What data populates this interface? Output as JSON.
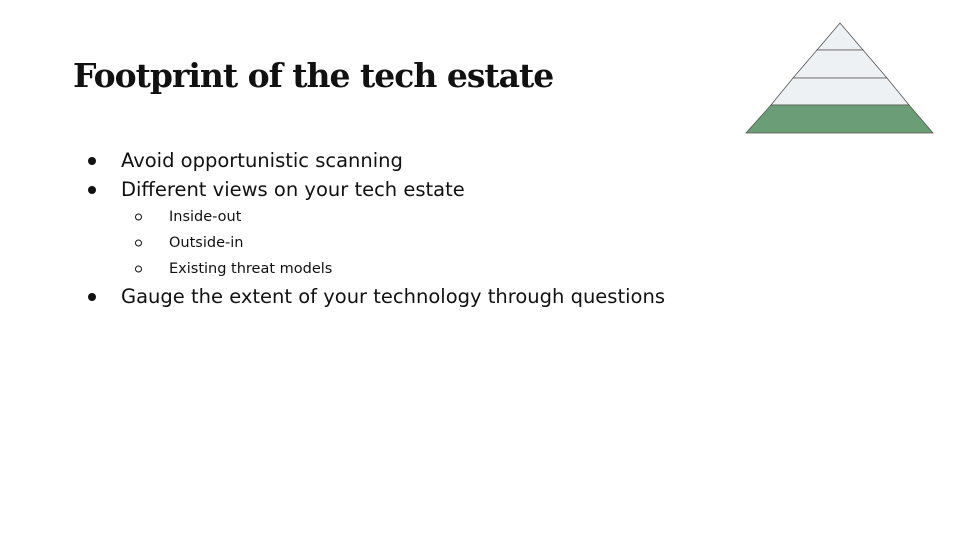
{
  "slide": {
    "title": "Footprint of the tech estate",
    "bullets": [
      {
        "text": "Avoid opportunistic scanning"
      },
      {
        "text": "Different views on your tech estate",
        "children": [
          {
            "text": "Inside-out"
          },
          {
            "text": "Outside-in"
          },
          {
            "text": "Existing threat models"
          }
        ]
      },
      {
        "text": "Gauge the extent of your technology through questions"
      }
    ]
  },
  "pyramid": {
    "layers": 4,
    "highlighted_layer": "bottom",
    "colors": {
      "layer_fill": "#eef1f4",
      "highlight_fill": "#6b9e76",
      "stroke": "#555555"
    }
  }
}
